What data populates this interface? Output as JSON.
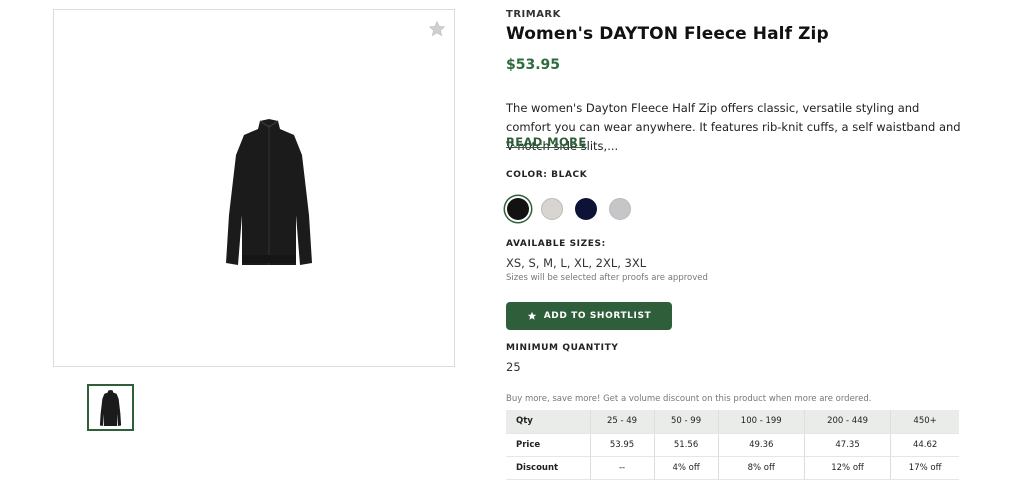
{
  "product": {
    "brand": "TRIMARK",
    "title": "Women's DAYTON Fleece Half Zip",
    "price": "$53.95",
    "description": "The women's Dayton Fleece Half Zip offers classic, versatile styling and comfort you can wear anywhere. It features rib-knit cuffs, a self waistband and V-notch side slits,...",
    "read_more": "READ MORE"
  },
  "gallery": {
    "favorite_icon": "star-icon",
    "main_image": "black-fleece-half-zip-jacket",
    "thumbnail_image": "black-fleece-half-zip-jacket"
  },
  "color": {
    "label": "COLOR: BLACK",
    "swatches": [
      {
        "name": "black",
        "hex": "#121212",
        "selected": true
      },
      {
        "name": "heather",
        "hex": "#d8d4cf",
        "selected": false
      },
      {
        "name": "navy",
        "hex": "#0c1336",
        "selected": false
      },
      {
        "name": "grey",
        "hex": "#c5c6c8",
        "selected": false
      }
    ]
  },
  "sizes": {
    "label": "AVAILABLE SIZES:",
    "values": "XS, S, M, L, XL, 2XL, 3XL",
    "note": "Sizes will be selected after proofs are approved"
  },
  "shortlist_button": {
    "label": "ADD TO SHORTLIST",
    "icon": "star-icon"
  },
  "minimum_quantity": {
    "label": "MINIMUM QUANTITY",
    "value": "25"
  },
  "pricing": {
    "note": "Buy more, save more! Get a volume discount on this product when more are ordered.",
    "header": [
      "Qty",
      "25 - 49",
      "50 - 99",
      "100 - 199",
      "200 - 449",
      "450+"
    ],
    "rows": [
      [
        "Price",
        "53.95",
        "51.56",
        "49.36",
        "47.35",
        "44.62"
      ],
      [
        "Discount",
        "--",
        "4% off",
        "8% off",
        "12% off",
        "17% off"
      ]
    ]
  },
  "colors": {
    "accent": "#2f5e3a",
    "price": "#2f6b3f",
    "table_header": "#e9ece9"
  }
}
